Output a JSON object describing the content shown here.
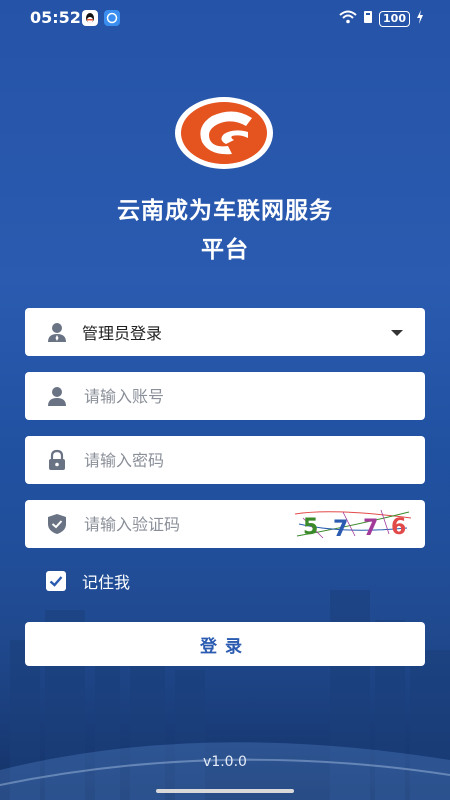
{
  "status_bar": {
    "time": "05:52",
    "battery": "100",
    "icons": [
      "qq-icon",
      "message-icon",
      "wifi-icon",
      "signal-icon",
      "battery-icon",
      "charging-icon"
    ]
  },
  "header": {
    "title_line1": "云南成为车联网服务",
    "title_line2": "平台"
  },
  "form": {
    "role_select": {
      "value": "管理员登录",
      "icon": "user-admin-icon"
    },
    "account": {
      "placeholder": "请输入账号",
      "icon": "user-icon"
    },
    "password": {
      "placeholder": "请输入密码",
      "icon": "lock-icon"
    },
    "captcha": {
      "placeholder": "请输入验证码",
      "icon": "shield-icon",
      "code": [
        "5",
        "7",
        "7",
        "6"
      ]
    },
    "remember": {
      "label": "记住我",
      "checked": true
    },
    "login_button": "登录"
  },
  "footer": {
    "version": "v1.0.0"
  },
  "colors": {
    "background": "#2553a7",
    "accent": "#2a5bb0",
    "logo_orange": "#e5531f",
    "captcha_colors": [
      "#3a8a2a",
      "#2a5bb0",
      "#a23a9a",
      "#e24a4a"
    ]
  }
}
